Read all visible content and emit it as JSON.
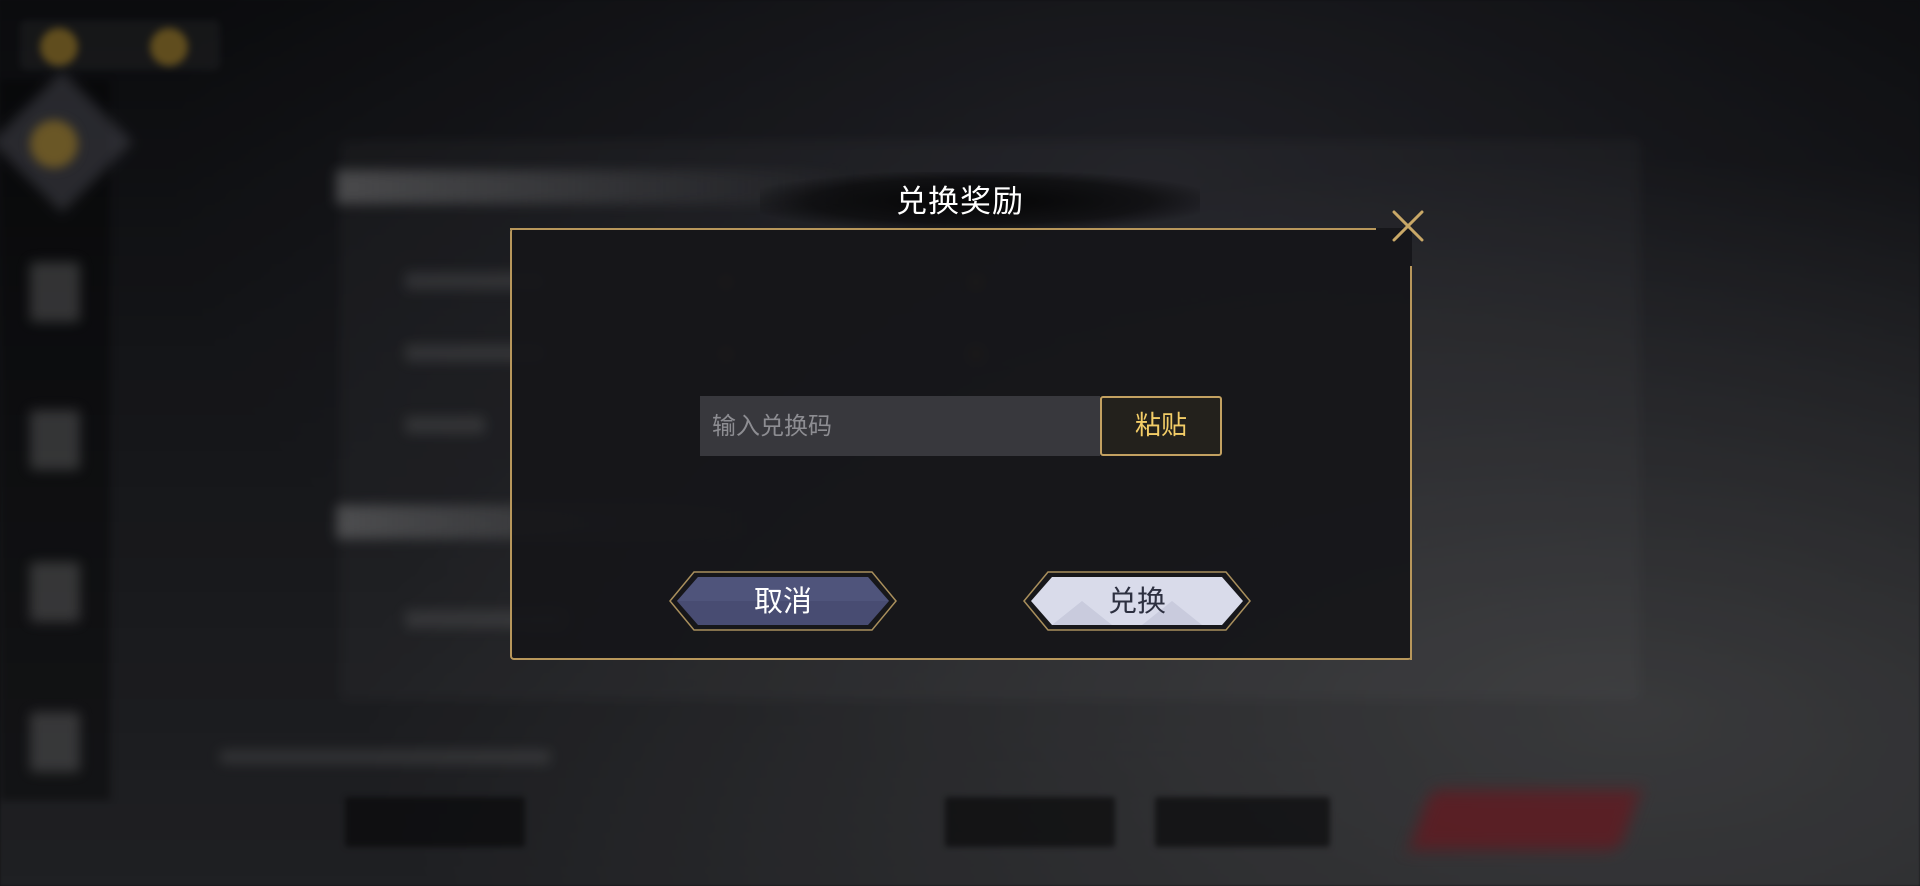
{
  "dialog": {
    "title": "兑换奖励",
    "input_placeholder": "输入兑换码",
    "input_value": "",
    "paste_label": "粘贴",
    "cancel_label": "取消",
    "exchange_label": "兑换"
  },
  "icons": {
    "close": "close-icon"
  },
  "colors": {
    "gold_border": "#b8975b",
    "paste_text": "#f3cd67",
    "cancel_fill": "#484c72",
    "exchange_fill": "#d9dbea"
  }
}
